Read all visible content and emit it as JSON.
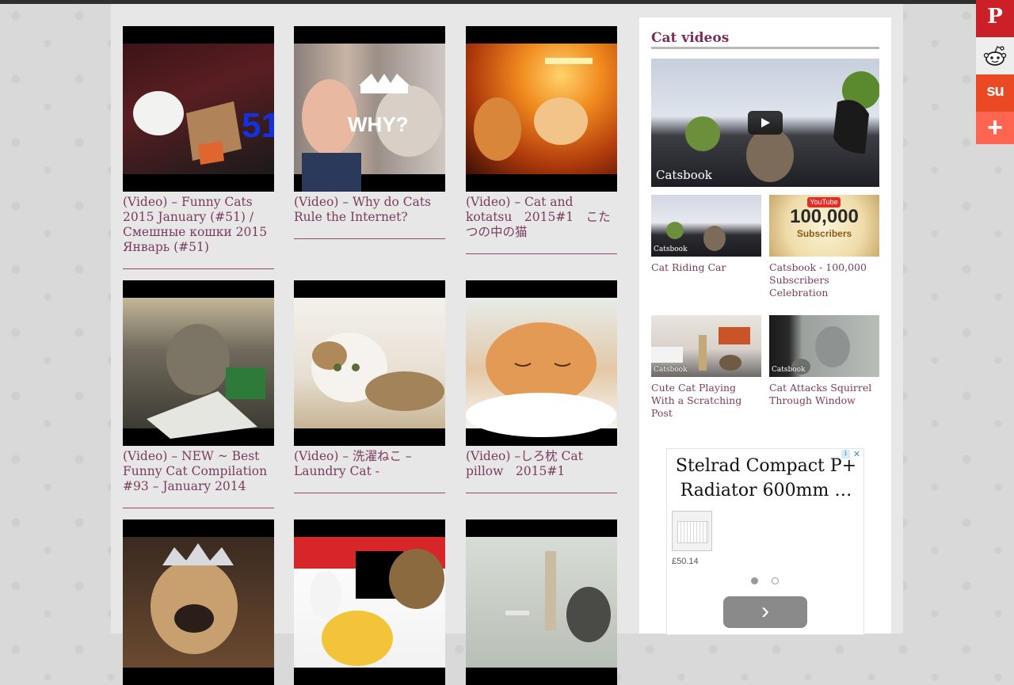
{
  "videos": [
    {
      "title": "(Video) – Funny Cats 2015 January (#51) / Смешные кошки 2015 Январь (#51)",
      "thumb_overlay": "51"
    },
    {
      "title": "(Video) – Why do Cats Rule the Internet?",
      "thumb_overlay": "WHY?"
    },
    {
      "title": "(Video) – Cat and kotatsu　2015#1　こたつの中の猫"
    },
    {
      "title": "(Video) – NEW ~ Best Funny Cat Compilation #93 – January 2014"
    },
    {
      "title": "(Video) – 洗濯ねこ – Laundry Cat -"
    },
    {
      "title": "(Video) –しろ枕 Cat pillow　2015#1"
    },
    {
      "title": ""
    },
    {
      "title": ""
    },
    {
      "title": ""
    }
  ],
  "sidebar": {
    "title": "Cat videos",
    "main_video_watermark": "Catsbook",
    "tiles": [
      {
        "label": "Cat Riding Car",
        "watermark": "Catsbook"
      },
      {
        "label": "Catsbook - 100,000 Subscribers Celebration",
        "overlay_brand": "YouTube",
        "overlay_count": "100,000",
        "overlay_word": "Subscribers"
      },
      {
        "label": "Cute Cat Playing With a Scratching Post",
        "watermark": "Catsbook"
      },
      {
        "label": "Cat Attacks Squirrel Through Window",
        "watermark": "Catsbook"
      }
    ]
  },
  "ad": {
    "title": "Stelrad Compact P+ Radiator 600mm …",
    "price": "£50.14",
    "choice_icon": "i",
    "close_icon": "✕",
    "next_icon": "›"
  },
  "share_buttons": [
    {
      "name": "pinterest",
      "glyph": "P",
      "color": "#cb2027"
    },
    {
      "name": "reddit",
      "glyph": "👽",
      "color": "#eeeeee"
    },
    {
      "name": "stumbleupon",
      "glyph": "su",
      "color": "#eb4924"
    },
    {
      "name": "more",
      "glyph": "+",
      "color": "#ff6550"
    }
  ]
}
